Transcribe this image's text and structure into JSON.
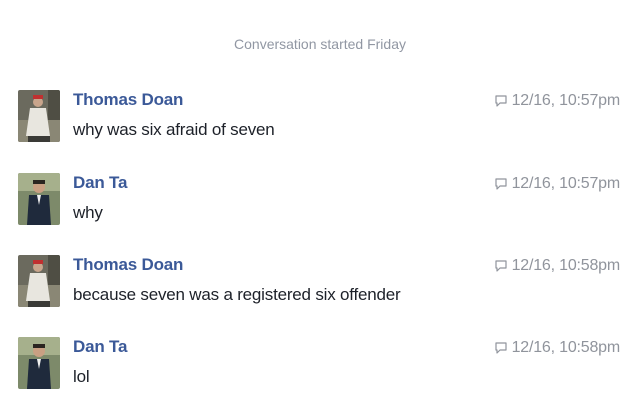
{
  "conversation": {
    "started_label": "Conversation started Friday",
    "messages": [
      {
        "sender": "Thomas Doan",
        "text": "why was six afraid of seven",
        "timestamp": "12/16, 10:57pm",
        "avatar": "thomas-avatar"
      },
      {
        "sender": "Dan Ta",
        "text": "why",
        "timestamp": "12/16, 10:57pm",
        "avatar": "dan-avatar"
      },
      {
        "sender": "Thomas Doan",
        "text": "because seven was a registered six offender",
        "timestamp": "12/16, 10:58pm",
        "avatar": "thomas-avatar"
      },
      {
        "sender": "Dan Ta",
        "text": "lol",
        "timestamp": "12/16, 10:58pm",
        "avatar": "dan-avatar"
      }
    ]
  },
  "colors": {
    "sender": "#3b5998",
    "meta": "#90949c",
    "text": "#1d2129"
  },
  "icons": {
    "timestamp_icon": "speech-bubble-icon"
  }
}
